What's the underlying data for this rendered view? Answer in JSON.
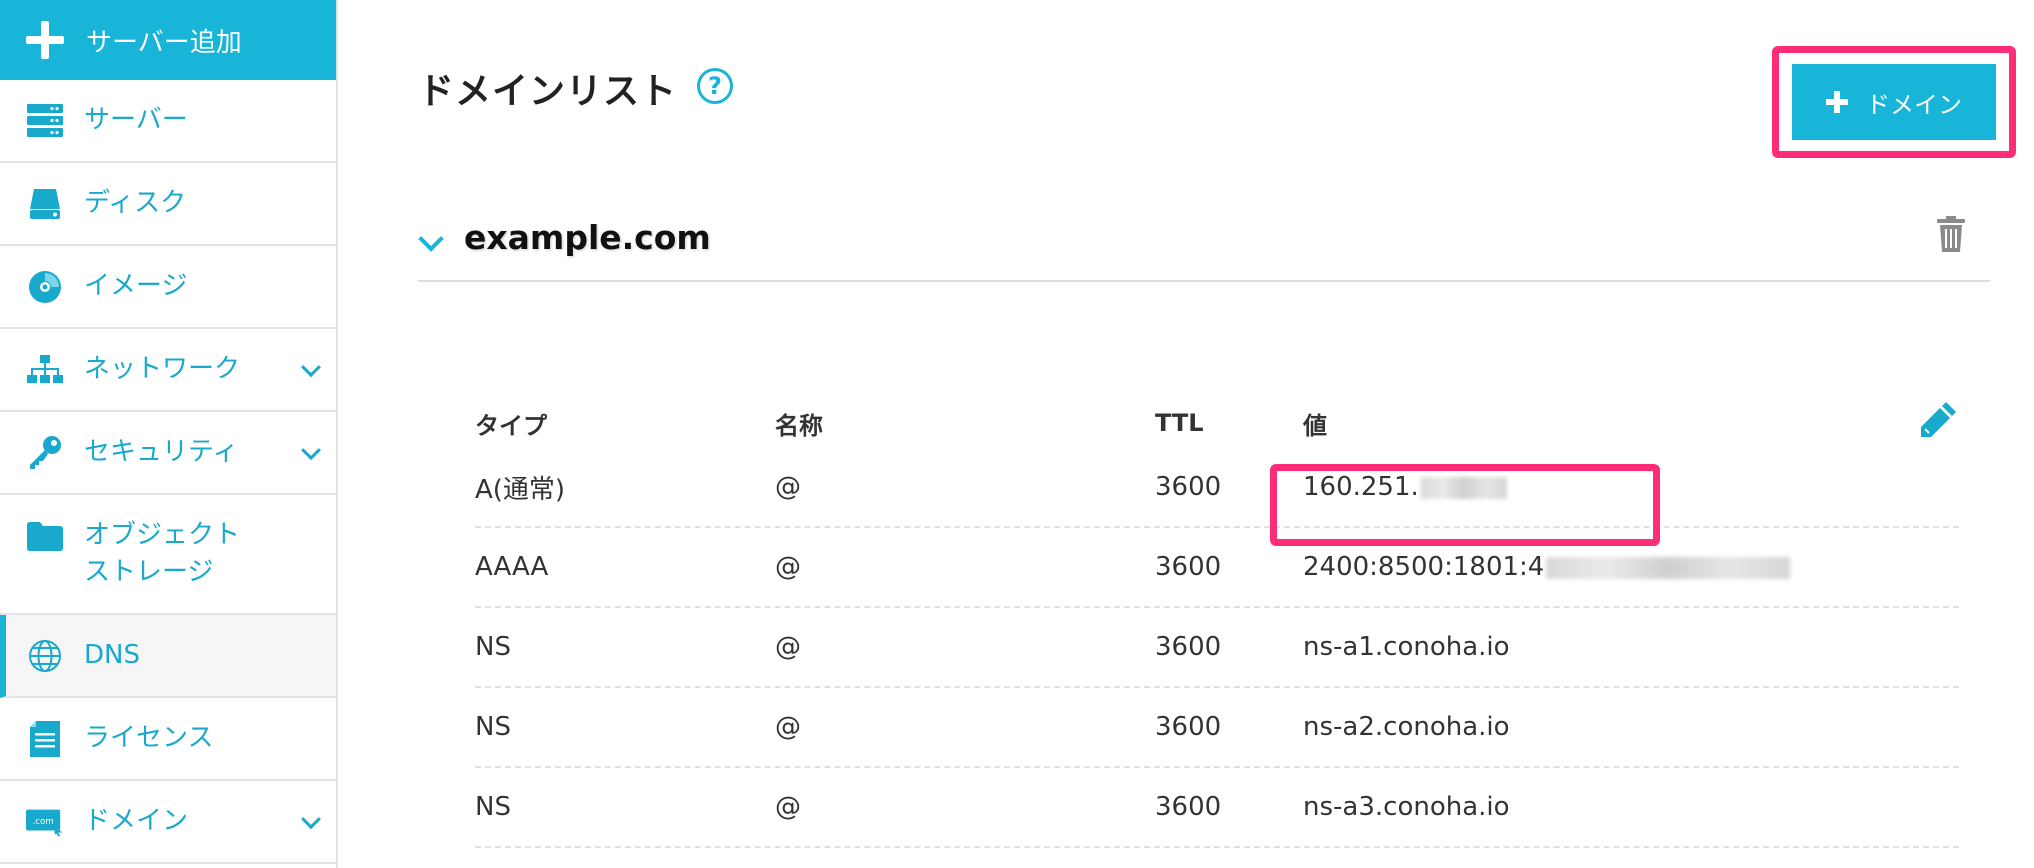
{
  "sidebar": {
    "add_server_label": "サーバー追加",
    "items": [
      {
        "label": "サーバー",
        "icon": "server-icon"
      },
      {
        "label": "ディスク",
        "icon": "disk-icon"
      },
      {
        "label": "イメージ",
        "icon": "image-icon"
      },
      {
        "label": "ネットワーク",
        "icon": "network-icon",
        "expandable": true
      },
      {
        "label": "セキュリティ",
        "icon": "key-icon",
        "expandable": true
      },
      {
        "label": "オブジェクト\nストレージ",
        "line1": "オブジェクト",
        "line2": "ストレージ",
        "icon": "folder-icon"
      },
      {
        "label": "DNS",
        "icon": "globe-icon",
        "active": true
      },
      {
        "label": "ライセンス",
        "icon": "license-icon"
      },
      {
        "label": "ドメイン",
        "icon": "domain-icon",
        "expandable": true
      }
    ]
  },
  "main": {
    "title": "ドメインリスト",
    "help_glyph": "?",
    "add_domain_label": "ドメイン",
    "domain": "example.com",
    "columns": {
      "type": "タイプ",
      "name": "名称",
      "ttl": "TTL",
      "value": "値"
    },
    "records": [
      {
        "type": "A(通常)",
        "name": "@",
        "ttl": "3600",
        "value": "160.251."
      },
      {
        "type": "AAAA",
        "name": "@",
        "ttl": "3600",
        "value": "2400:8500:1801:4"
      },
      {
        "type": "NS",
        "name": "@",
        "ttl": "3600",
        "value": "ns-a1.conoha.io"
      },
      {
        "type": "NS",
        "name": "@",
        "ttl": "3600",
        "value": "ns-a2.conoha.io"
      },
      {
        "type": "NS",
        "name": "@",
        "ttl": "3600",
        "value": "ns-a3.conoha.io"
      }
    ]
  },
  "colors": {
    "accent": "#19b5d8",
    "highlight": "#ff2d77"
  }
}
